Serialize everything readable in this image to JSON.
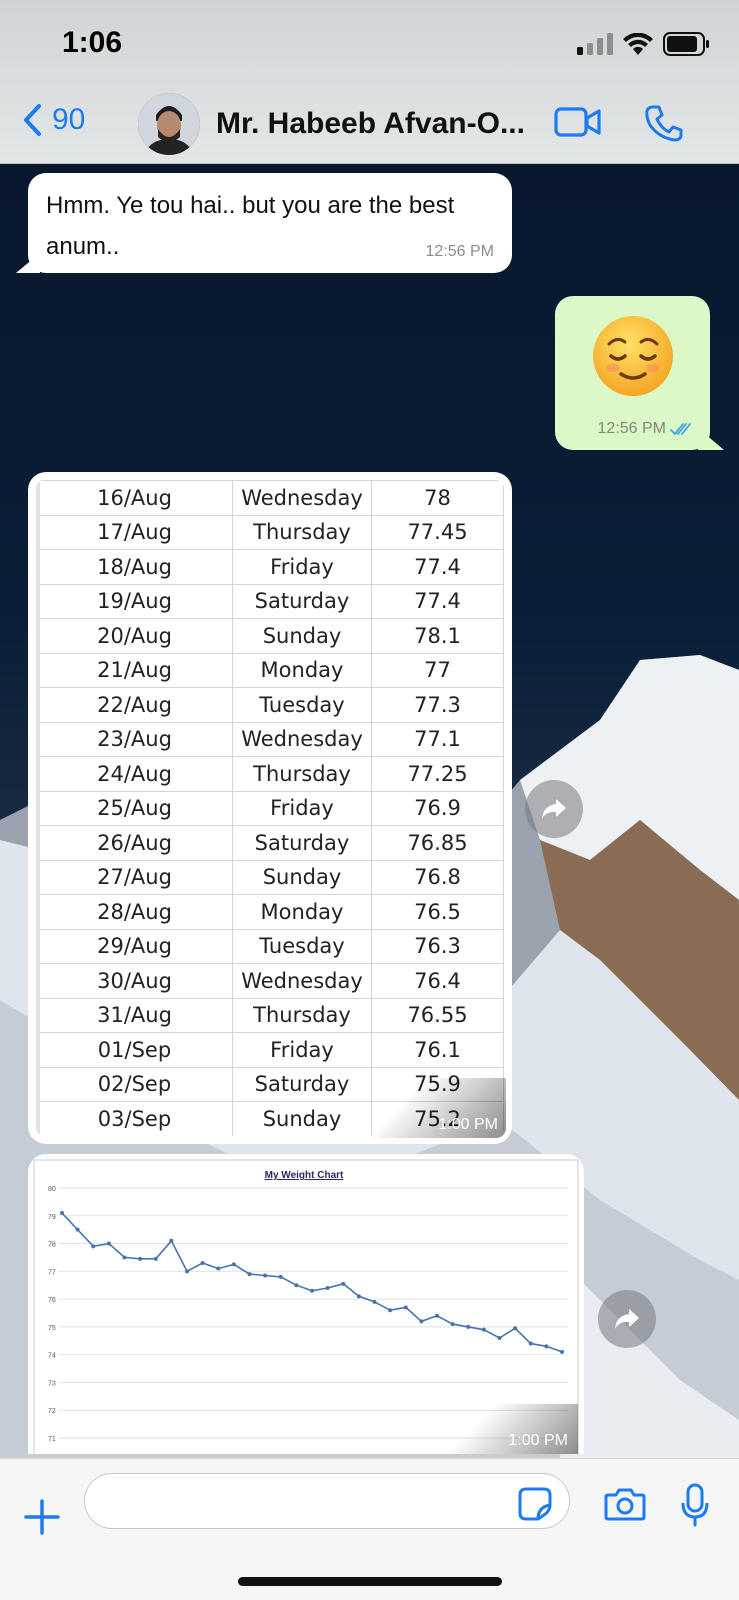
{
  "status_bar": {
    "time": "1:06"
  },
  "header": {
    "back_count": "90",
    "contact_name": "Mr. Habeeb Afvan-O..."
  },
  "messages": {
    "incoming": {
      "text": "Hmm. Ye tou hai.. but you are the best anum..",
      "time": "12:56 PM"
    },
    "outgoing": {
      "emoji": "relieved-face",
      "time": "12:56 PM",
      "status": "read"
    },
    "table_image": {
      "time": "1:00 PM",
      "rows": [
        [
          "16/Aug",
          "Wednesday",
          "78"
        ],
        [
          "17/Aug",
          "Thursday",
          "77.45"
        ],
        [
          "18/Aug",
          "Friday",
          "77.4"
        ],
        [
          "19/Aug",
          "Saturday",
          "77.4"
        ],
        [
          "20/Aug",
          "Sunday",
          "78.1"
        ],
        [
          "21/Aug",
          "Monday",
          "77"
        ],
        [
          "22/Aug",
          "Tuesday",
          "77.3"
        ],
        [
          "23/Aug",
          "Wednesday",
          "77.1"
        ],
        [
          "24/Aug",
          "Thursday",
          "77.25"
        ],
        [
          "25/Aug",
          "Friday",
          "76.9"
        ],
        [
          "26/Aug",
          "Saturday",
          "76.85"
        ],
        [
          "27/Aug",
          "Sunday",
          "76.8"
        ],
        [
          "28/Aug",
          "Monday",
          "76.5"
        ],
        [
          "29/Aug",
          "Tuesday",
          "76.3"
        ],
        [
          "30/Aug",
          "Wednesday",
          "76.4"
        ],
        [
          "31/Aug",
          "Thursday",
          "76.55"
        ],
        [
          "01/Sep",
          "Friday",
          "76.1"
        ],
        [
          "02/Sep",
          "Saturday",
          "75.9"
        ],
        [
          "03/Sep",
          "Sunday",
          "75.2"
        ]
      ]
    },
    "chart_image": {
      "time": "1:00 PM"
    }
  },
  "composer": {
    "placeholder": ""
  },
  "colors": {
    "accent": "#1d7bf1",
    "outgoing_bubble": "#dcf8c6",
    "incoming_bubble": "#ffffff",
    "chart_line": "#4a72b0"
  },
  "chart_data": {
    "type": "line",
    "title": "My Weight Chart",
    "xlabel": "",
    "ylabel": "",
    "ylim": [
      71,
      80
    ],
    "yticks": [
      71,
      72,
      73,
      74,
      75,
      76,
      77,
      78,
      79,
      80
    ],
    "grid": true,
    "legend": "none",
    "series": [
      {
        "values": [
          79.1,
          78.5,
          77.9,
          78.0,
          77.5,
          77.45,
          77.45,
          78.1,
          77.0,
          77.3,
          77.1,
          77.25,
          76.9,
          76.85,
          76.8,
          76.5,
          76.3,
          76.4,
          76.55,
          76.1,
          75.9,
          75.6,
          75.7,
          75.2,
          75.4,
          75.1,
          75.0,
          74.9,
          74.6,
          74.95,
          74.4,
          74.3,
          74.1
        ]
      }
    ]
  }
}
